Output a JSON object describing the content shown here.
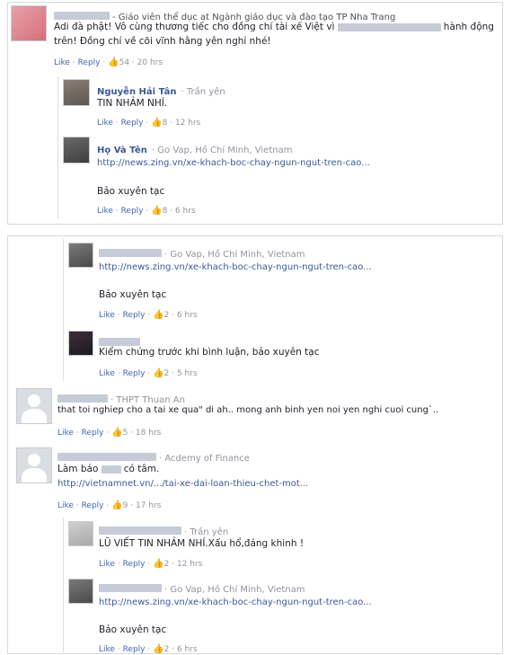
{
  "c1": {
    "meta": "- Giáo viên thể dục at Ngành giáo dục và đào tạo TP Nha Trang",
    "text_a": "Adi đà phật! Vô cùng thương tiếc cho đồng chí tài xế Việt vì",
    "text_b": "hành động",
    "text_c": "trên! Đồng chí về cõi vĩnh hằng yên nghỉ nhé!",
    "likes": "54",
    "time": "20 hrs"
  },
  "r1": {
    "name": "Nguyễn Hải Tân",
    "meta": "· Trần yên",
    "text": "TIN NHẢM NHÍ.",
    "likes": "8",
    "time": "12 hrs"
  },
  "r2": {
    "name": "Họ Và Tên",
    "meta": "· Go Vap, Hồ Chí Minh, Vietnam",
    "link": "http://news.zing.vn/xe-khach-boc-chay-ngun-ngut-tren-cao...",
    "text": "Bảo xuyên tạc",
    "likes": "8",
    "time": "6 hrs"
  },
  "r3": {
    "meta": "· Go Vap, Hồ Chí Minh, Vietnam",
    "link": "http://news.zing.vn/xe-khach-boc-chay-ngun-ngut-tren-cao...",
    "text": "Bảo xuyên tạc",
    "likes": "2",
    "time": "6 hrs"
  },
  "r4": {
    "text": "Kiểm chứng trước khi bình luận, bảo xuyên tạc",
    "likes": "2",
    "time": "5 hrs"
  },
  "c2": {
    "meta": "· THPT Thuan An",
    "text": "that toi nghiep cho a tai xe qua\" di ah.. mong anh binh yen noi yen nghi cuoi cung`..",
    "likes": "5",
    "time": "18 hrs"
  },
  "c3": {
    "meta": "· Acdemy of Finance",
    "text_a": "Làm báo",
    "text_b": "có tâm.",
    "link": "http://vietnamnet.vn/.../tai-xe-dai-loan-thieu-chet-mot...",
    "likes": "9",
    "time": "17 hrs"
  },
  "r5": {
    "meta": "· Trần yên",
    "text": "LŨ VIẾT TIN NHẢM NHÍ.Xấu hổ,đáng khinh !",
    "likes": "2",
    "time": "12 hrs"
  },
  "r6": {
    "meta": "· Go Vap, Hồ Chí Minh, Vietnam",
    "link": "http://news.zing.vn/xe-khach-boc-chay-ngun-ngut-tren-cao...",
    "text": "Bảo xuyên tạc",
    "likes": "2",
    "time": "6 hrs"
  },
  "actions": {
    "like": "Like",
    "reply": "Reply",
    "dot": "·"
  },
  "colors": {
    "link": "#3b5998",
    "meta": "#90949c",
    "border": "#d6d9de"
  }
}
